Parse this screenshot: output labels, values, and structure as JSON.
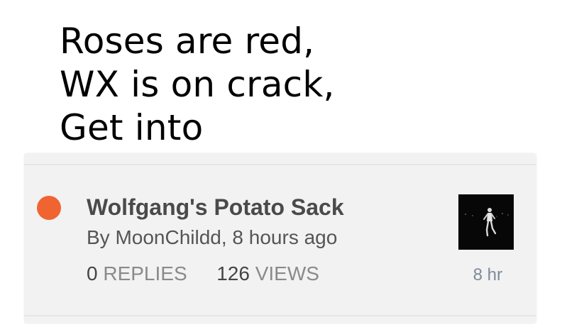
{
  "caption": {
    "line1": "Roses are red,",
    "line2": "WX is on crack,",
    "line3": "Get into"
  },
  "topic": {
    "title": "Wolfgang's Potato Sack",
    "byline": "By MoonChildd, 8 hours ago",
    "replies_count": "0",
    "replies_label": "REPLIES",
    "views_count": "126",
    "views_label": "VIEWS",
    "age": "8 hr",
    "unread_color": "#f06432",
    "thumbnail_icon": "runner-photo-thumbnail"
  }
}
